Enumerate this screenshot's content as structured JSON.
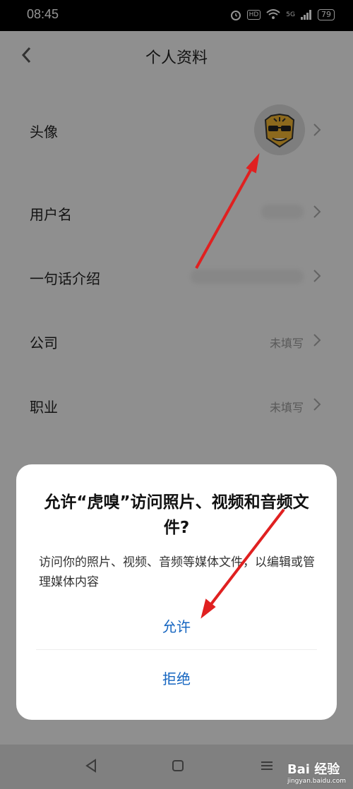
{
  "status": {
    "time": "08:45",
    "battery": "79",
    "hd": "HD",
    "network": "5G"
  },
  "header": {
    "title": "个人资料"
  },
  "rows": [
    {
      "label": "头像",
      "value": ""
    },
    {
      "label": "用户名",
      "value": ""
    },
    {
      "label": "一句话介绍",
      "value": ""
    },
    {
      "label": "公司",
      "value": "未填写"
    },
    {
      "label": "职业",
      "value": "未填写"
    }
  ],
  "dialog": {
    "title": "允许“虎嗅”访问照片、视频和音频文件?",
    "message": "访问你的照片、视频、音频等媒体文件，以编辑或管理媒体内容",
    "allow": "允许",
    "deny": "拒绝"
  },
  "watermark": {
    "main": "Bai 经验",
    "sub": "jingyan.baidu.com"
  },
  "colors": {
    "accent": "#1565c0",
    "arrow": "#e02020"
  }
}
